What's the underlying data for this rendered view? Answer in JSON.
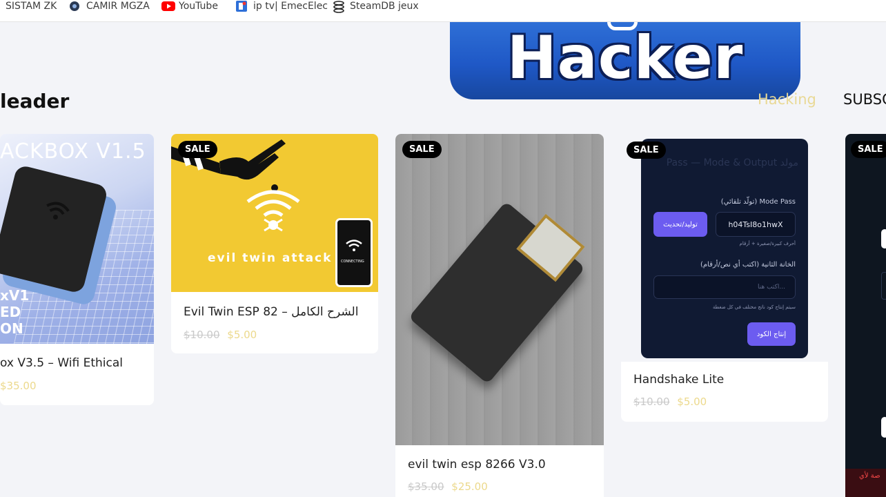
{
  "bookmarks": [
    {
      "label": "SISTAM ZK",
      "icon": "none"
    },
    {
      "label": "CAMIR MGZA",
      "icon": "camera-icon"
    },
    {
      "label": "YouTube",
      "icon": "youtube-icon"
    },
    {
      "label": "ip tv| EmecElec",
      "icon": "site-favicon-icon"
    },
    {
      "label": "SteamDB jeux",
      "icon": "steamdb-icon"
    }
  ],
  "banner": {
    "text": "Hacker"
  },
  "page": {
    "heading": "leader"
  },
  "nav": {
    "hacking": "Hacking",
    "subscribe": "SUBSC"
  },
  "products": [
    {
      "title": "ox V3.5 – Wifi Ethical",
      "old_price": "",
      "price": "$35.00",
      "image_text": "ACKBOX V1.5",
      "image_side_text": [
        "xV1",
        "ED",
        "ON"
      ]
    },
    {
      "title": "Evil Twin ESP 82 – الشرح الكامل",
      "old_price": "$10.00",
      "price": "$5.00",
      "badge": "SALE",
      "image_text": "evil twin attack",
      "image_phone_caption": "CONNECTING"
    },
    {
      "title": "evil twin esp 8266 V3.0",
      "old_price": "$35.00",
      "price": "$25.00",
      "badge": "SALE"
    },
    {
      "title": "Handshake Lite",
      "old_price": "$10.00",
      "price": "$5.00",
      "badge": "SALE",
      "generator": {
        "title": "مولد Pass — Mode & Output",
        "mode_label": "Mode Pass (تولّد تلقائي)",
        "generated_value": "h04TsI8o1hwX",
        "generate_button": "توليد/تحديث",
        "note1": "أحرف كبيرة/صغيرة + أرقام",
        "second_label": "الخانة الثانية (اكتب أي نص/أرقام)",
        "input_placeholder": "اكتب هنا...",
        "note2": "سيتم إنتاج كود ناتج مختلف في كل ضغطة",
        "produce_button": "إنتاج الكود"
      }
    },
    {
      "title": "",
      "badge": "SALE",
      "image_text": "صة لأي"
    }
  ],
  "colors": {
    "sale_price": "#ecd98c",
    "old_price": "#c9c9c9",
    "nav_hacking": "#e9d996",
    "generator_bg": "#101a33",
    "accent": "#6c5cf0"
  }
}
